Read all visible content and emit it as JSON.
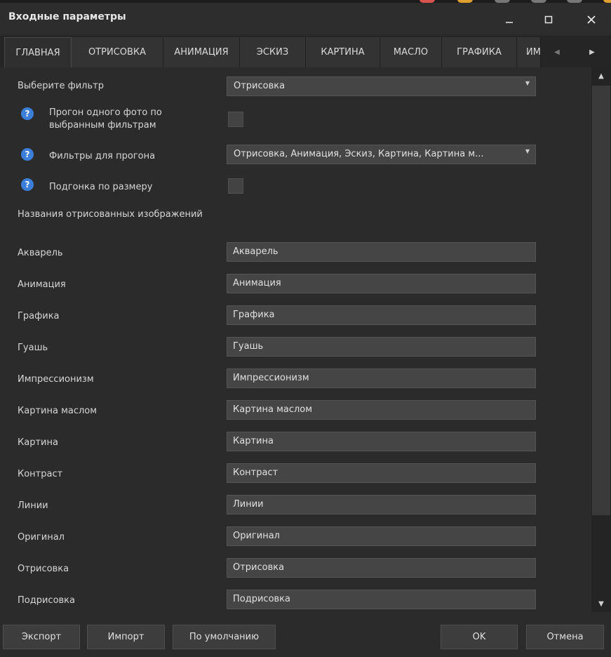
{
  "window": {
    "title": "Входные параметры",
    "minimize_icon": "minimize-icon",
    "maximize_icon": "maximize-icon",
    "close_icon": "close-icon"
  },
  "tabs": [
    {
      "label": "ГЛАВНАЯ",
      "active": true
    },
    {
      "label": "ОТРИСОВКА",
      "active": false
    },
    {
      "label": "АНИМАЦИЯ",
      "active": false
    },
    {
      "label": "ЭСКИЗ",
      "active": false
    },
    {
      "label": "КАРТИНА",
      "active": false
    },
    {
      "label": "МАСЛО",
      "active": false
    },
    {
      "label": "ГРАФИКА",
      "active": false
    },
    {
      "label": "ИМ",
      "active": false
    }
  ],
  "form": {
    "filter_label": "Выберите фильтр",
    "filter_value": "Отрисовка",
    "batch_label_line1": "Прогон одного фото по",
    "batch_label_line2": "выбранным фильтрам",
    "batch_checked": false,
    "filters_label": "Фильтры для прогона",
    "filters_value": "Отрисовка, Анимация, Эскиз, Картина, Картина м...",
    "fit_label": "Подгонка по размеру",
    "fit_checked": false,
    "names_header": "Названия отрисованных изображений"
  },
  "names": [
    {
      "label": "Акварель",
      "value": "Акварель"
    },
    {
      "label": "Анимация",
      "value": "Анимация"
    },
    {
      "label": "Графика",
      "value": "Графика"
    },
    {
      "label": "Гуашь",
      "value": "Гуашь"
    },
    {
      "label": "Импрессионизм",
      "value": "Импрессионизм"
    },
    {
      "label": "Картина маслом",
      "value": "Картина маслом"
    },
    {
      "label": "Картина",
      "value": "Картина"
    },
    {
      "label": "Контраст",
      "value": "Контраст"
    },
    {
      "label": "Линии",
      "value": "Линии"
    },
    {
      "label": "Оригинал",
      "value": "Оригинал"
    },
    {
      "label": "Отрисовка",
      "value": "Отрисовка"
    },
    {
      "label": "Подрисовка",
      "value": "Подрисовка"
    }
  ],
  "footer": {
    "export": "Экспорт",
    "import": "Импорт",
    "defaults": "По умолчанию",
    "ok": "OK",
    "cancel": "Отмена"
  },
  "colors": {
    "background": "#2b2b2b",
    "field": "#454545",
    "help_icon": "#3b7fdb",
    "text": "#d6d6d6"
  }
}
